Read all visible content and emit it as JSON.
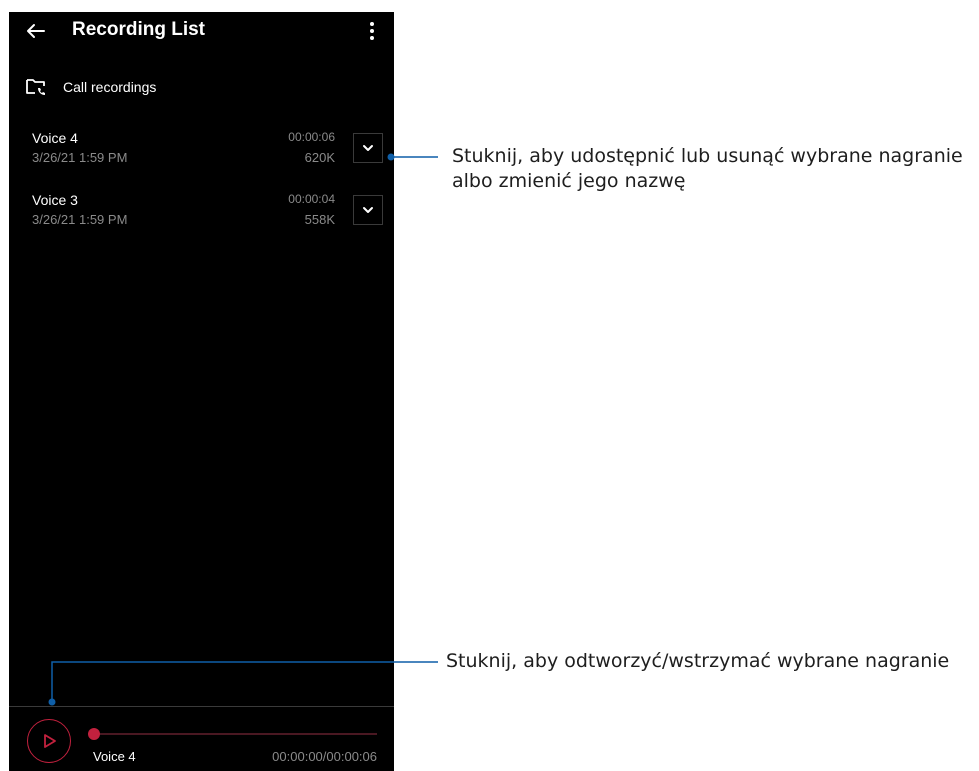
{
  "app_bar": {
    "title": "Recording List",
    "back_icon": "arrow-left-icon",
    "menu_icon": "more-vertical-icon"
  },
  "folder": {
    "label": "Call recordings",
    "icon": "folder-phone-icon"
  },
  "recordings": [
    {
      "name": "Voice 4",
      "date": "3/26/21 1:59 PM",
      "duration": "00:00:06",
      "size": "620K"
    },
    {
      "name": "Voice 3",
      "date": "3/26/21 1:59 PM",
      "duration": "00:00:04",
      "size": "558K"
    }
  ],
  "player": {
    "name": "Voice 4",
    "time": "00:00:00/00:00:06",
    "progress": 0,
    "accent": "#c2213e"
  },
  "callouts": {
    "expand": "Stuknij, aby udostępnić lub usunąć wybrane nagranie albo zmienić jego nazwę",
    "play": "Stuknij, aby odtworzyć/wstrzymać wybrane nagranie"
  },
  "colors": {
    "callout_line": "#0f5fa8",
    "background": "#000000",
    "muted_text": "#8a8a8a"
  }
}
